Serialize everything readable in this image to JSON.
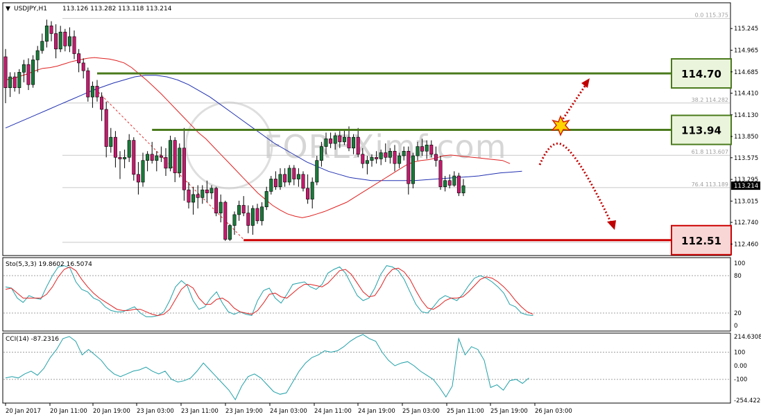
{
  "chart_data": [
    {
      "type": "candlestick",
      "header": {
        "symbol": "USDJPY,H1",
        "ohlc": "113.126 113.282 113.118 113.214"
      },
      "watermark": "FOREXimf.com",
      "ylim": [
        112.32,
        115.56
      ],
      "y_ticks": [
        "115.245",
        "114.965",
        "114.685",
        "114.410",
        "114.130",
        "113.850",
        "113.575",
        "113.295",
        "113.015",
        "112.740",
        "112.460"
      ],
      "y_tick_values": [
        115.245,
        114.965,
        114.685,
        114.41,
        114.13,
        113.85,
        113.575,
        113.295,
        113.015,
        112.74,
        112.46
      ],
      "current_price": "113.214",
      "current_price_value": 113.214,
      "x_labels": [
        "20 Jan 2017",
        "20 Jan 11:00",
        "20 Jan 19:00",
        "23 Jan 03:00",
        "23 Jan 11:00",
        "23 Jan 19:00",
        "24 Jan 03:00",
        "24 Jan 11:00",
        "24 Jan 19:00",
        "25 Jan 03:00",
        "25 Jan 11:00",
        "25 Jan 19:00",
        "26 Jan 03:00"
      ],
      "fibonacci": [
        {
          "label": "0.0  115.375",
          "value": 115.375
        },
        {
          "label": "38.2  114.282",
          "value": 114.282
        },
        {
          "label": "61.8  113.607",
          "value": 113.607
        },
        {
          "label": "76.4  113.189",
          "value": 113.189
        }
      ],
      "levels": [
        {
          "label": "114.70",
          "value": 114.665,
          "color": "#4a7a1c",
          "box_fill": "#eaf4dc",
          "start_bar": 20
        },
        {
          "label": "113.94",
          "value": 113.935,
          "color": "#4a7a1c",
          "box_fill": "#eaf4dc",
          "start_bar": 32
        },
        {
          "label": "112.51",
          "value": 112.51,
          "color": "#cc0000",
          "box_fill": "#f9d6d6",
          "start_bar": 52
        }
      ],
      "colors": {
        "bull": "#1a7a3a",
        "bear": "#c8186e",
        "ma_fast": "#e02020",
        "ma_slow": "#2030b0",
        "arrow": "#c00000"
      },
      "candles": [
        [
          114.88,
          114.98,
          114.28,
          114.48
        ],
        [
          114.48,
          114.68,
          114.36,
          114.62
        ],
        [
          114.62,
          114.68,
          114.43,
          114.48
        ],
        [
          114.48,
          114.72,
          114.4,
          114.68
        ],
        [
          114.68,
          114.84,
          114.55,
          114.78
        ],
        [
          114.78,
          114.86,
          114.45,
          114.52
        ],
        [
          114.52,
          114.9,
          114.48,
          114.84
        ],
        [
          114.84,
          115.02,
          114.68,
          114.96
        ],
        [
          114.96,
          115.18,
          114.92,
          115.08
        ],
        [
          115.08,
          115.36,
          115.0,
          115.28
        ],
        [
          115.28,
          115.34,
          115.08,
          115.18
        ],
        [
          115.18,
          115.3,
          114.86,
          114.98
        ],
        [
          114.98,
          115.28,
          114.94,
          115.2
        ],
        [
          115.2,
          115.24,
          114.95,
          115.02
        ],
        [
          115.02,
          115.26,
          114.94,
          115.14
        ],
        [
          115.14,
          115.22,
          114.85,
          114.92
        ],
        [
          114.92,
          114.98,
          114.68,
          114.8
        ],
        [
          114.8,
          114.86,
          114.6,
          114.7
        ],
        [
          114.7,
          114.74,
          114.3,
          114.36
        ],
        [
          114.36,
          114.56,
          114.22,
          114.5
        ],
        [
          114.5,
          114.58,
          114.3,
          114.36
        ],
        [
          114.36,
          114.42,
          114.05,
          114.2
        ],
        [
          114.2,
          114.3,
          113.58,
          113.72
        ],
        [
          113.72,
          113.96,
          113.64,
          113.84
        ],
        [
          113.84,
          113.92,
          113.45,
          113.58
        ],
        [
          113.58,
          113.66,
          113.3,
          113.56
        ],
        [
          113.56,
          113.68,
          113.44,
          113.58
        ],
        [
          113.58,
          113.88,
          113.52,
          113.8
        ],
        [
          113.8,
          113.84,
          113.28,
          113.36
        ],
        [
          113.36,
          113.52,
          113.1,
          113.26
        ],
        [
          113.26,
          113.64,
          113.2,
          113.54
        ],
        [
          113.54,
          113.66,
          113.4,
          113.62
        ],
        [
          113.62,
          113.78,
          113.5,
          113.54
        ],
        [
          113.54,
          113.66,
          113.4,
          113.6
        ],
        [
          113.6,
          113.72,
          113.52,
          113.58
        ],
        [
          113.58,
          113.7,
          113.34,
          113.44
        ],
        [
          113.44,
          113.86,
          113.4,
          113.8
        ],
        [
          113.8,
          113.84,
          113.26,
          113.38
        ],
        [
          113.38,
          113.76,
          113.32,
          113.7
        ],
        [
          113.7,
          113.96,
          113.02,
          113.16
        ],
        [
          113.16,
          113.26,
          112.92,
          113.0
        ],
        [
          113.0,
          113.2,
          112.84,
          113.1
        ],
        [
          113.1,
          113.22,
          112.92,
          113.06
        ],
        [
          113.06,
          113.22,
          112.98,
          113.16
        ],
        [
          113.16,
          113.28,
          113.0,
          113.12
        ],
        [
          113.12,
          113.22,
          113.04,
          113.18
        ],
        [
          113.18,
          113.2,
          112.82,
          112.86
        ],
        [
          112.86,
          113.1,
          112.74,
          113.0
        ],
        [
          113.0,
          113.02,
          112.5,
          112.52
        ],
        [
          112.52,
          112.72,
          112.5,
          112.7
        ],
        [
          112.7,
          112.88,
          112.58,
          112.84
        ],
        [
          112.84,
          113.02,
          112.76,
          112.96
        ],
        [
          112.96,
          113.08,
          112.82,
          112.86
        ],
        [
          112.86,
          112.96,
          112.6,
          112.7
        ],
        [
          112.7,
          112.96,
          112.58,
          112.92
        ],
        [
          112.92,
          112.98,
          112.72,
          112.76
        ],
        [
          112.76,
          113.0,
          112.7,
          112.94
        ],
        [
          112.94,
          113.2,
          112.9,
          113.14
        ],
        [
          113.14,
          113.34,
          113.1,
          113.3
        ],
        [
          113.3,
          113.4,
          113.16,
          113.2
        ],
        [
          113.2,
          113.44,
          113.16,
          113.36
        ],
        [
          113.36,
          113.44,
          113.2,
          113.26
        ],
        [
          113.26,
          113.48,
          113.22,
          113.44
        ],
        [
          113.44,
          113.48,
          113.22,
          113.3
        ],
        [
          113.3,
          113.44,
          113.2,
          113.36
        ],
        [
          113.36,
          113.4,
          113.14,
          113.18
        ],
        [
          113.18,
          113.36,
          112.98,
          113.04
        ],
        [
          113.04,
          113.32,
          112.92,
          113.26
        ],
        [
          113.26,
          113.6,
          113.22,
          113.54
        ],
        [
          113.54,
          113.78,
          113.46,
          113.72
        ],
        [
          113.72,
          113.9,
          113.62,
          113.82
        ],
        [
          113.82,
          113.9,
          113.7,
          113.76
        ],
        [
          113.76,
          113.9,
          113.68,
          113.86
        ],
        [
          113.86,
          113.92,
          113.7,
          113.78
        ],
        [
          113.78,
          113.94,
          113.74,
          113.84
        ],
        [
          113.84,
          113.98,
          113.66,
          113.7
        ],
        [
          113.7,
          113.88,
          113.62,
          113.84
        ],
        [
          113.84,
          113.96,
          113.58,
          113.62
        ],
        [
          113.62,
          113.7,
          113.44,
          113.5
        ],
        [
          113.5,
          113.6,
          113.36,
          113.54
        ],
        [
          113.54,
          113.62,
          113.46,
          113.58
        ],
        [
          113.58,
          113.66,
          113.5,
          113.56
        ],
        [
          113.56,
          113.68,
          113.48,
          113.64
        ],
        [
          113.64,
          113.76,
          113.52,
          113.58
        ],
        [
          113.58,
          113.7,
          113.5,
          113.66
        ],
        [
          113.66,
          113.74,
          113.4,
          113.5
        ],
        [
          113.5,
          113.64,
          113.44,
          113.6
        ],
        [
          113.6,
          113.72,
          113.54,
          113.66
        ],
        [
          113.66,
          113.72,
          113.1,
          113.24
        ],
        [
          113.24,
          113.64,
          113.18,
          113.6
        ],
        [
          113.6,
          113.78,
          113.54,
          113.72
        ],
        [
          113.72,
          113.82,
          113.6,
          113.66
        ],
        [
          113.66,
          113.8,
          113.56,
          113.74
        ],
        [
          113.74,
          113.8,
          113.58,
          113.62
        ],
        [
          113.62,
          113.72,
          113.46,
          113.54
        ],
        [
          113.54,
          113.6,
          113.16,
          113.2
        ],
        [
          113.2,
          113.34,
          113.14,
          113.28
        ],
        [
          113.28,
          113.36,
          113.18,
          113.22
        ],
        [
          113.22,
          113.4,
          113.2,
          113.34
        ],
        [
          113.34,
          113.38,
          113.08,
          113.12
        ],
        [
          113.12,
          113.3,
          113.08,
          113.214
        ]
      ],
      "ma_fast": [
        114.58,
        114.6,
        114.63,
        114.66,
        114.7,
        114.73,
        114.74,
        114.76,
        114.79,
        114.82,
        114.84,
        114.86,
        114.87,
        114.86,
        114.85,
        114.83,
        114.8,
        114.74,
        114.66,
        114.58,
        114.49,
        114.4,
        114.3,
        114.2,
        114.1,
        114.0,
        113.9,
        113.82,
        113.72,
        113.62,
        113.52,
        113.42,
        113.32,
        113.22,
        113.12,
        113.04,
        112.96,
        112.9,
        112.85,
        112.82,
        112.8,
        112.82,
        112.85,
        112.88,
        112.92,
        112.96,
        113.0,
        113.06,
        113.12,
        113.18,
        113.24,
        113.3,
        113.36,
        113.42,
        113.48,
        113.52,
        113.54,
        113.55,
        113.57,
        113.6,
        113.61,
        113.6,
        113.59,
        113.58,
        113.57,
        113.56,
        113.55,
        113.54,
        113.5
      ],
      "ma_slow": [
        113.96,
        114.02,
        114.08,
        114.14,
        114.2,
        114.26,
        114.32,
        114.38,
        114.44,
        114.49,
        114.54,
        114.58,
        114.62,
        114.64,
        114.64,
        114.62,
        114.58,
        114.52,
        114.44,
        114.36,
        114.26,
        114.16,
        114.06,
        113.96,
        113.86,
        113.76,
        113.68,
        113.6,
        113.52,
        113.46,
        113.4,
        113.36,
        113.32,
        113.3,
        113.28,
        113.28,
        113.28,
        113.28,
        113.28,
        113.29,
        113.3,
        113.31,
        113.32,
        113.33,
        113.34,
        113.36,
        113.38,
        113.39,
        113.4
      ],
      "sto_header": "Sto(5,3,3) 19.8602 16.5074",
      "sto_ticks": [
        "100",
        "80",
        "20",
        "0"
      ],
      "sto_main": [
        62,
        60,
        44,
        37,
        48,
        44,
        42,
        62,
        80,
        94,
        96,
        92,
        70,
        58,
        54,
        44,
        40,
        30,
        24,
        22,
        22,
        26,
        30,
        20,
        14,
        14,
        16,
        22,
        40,
        62,
        72,
        64,
        40,
        26,
        30,
        44,
        54,
        36,
        22,
        18,
        22,
        18,
        16,
        40,
        56,
        60,
        44,
        36,
        50,
        66,
        68,
        70,
        62,
        58,
        66,
        84,
        90,
        94,
        84,
        66,
        48,
        40,
        44,
        60,
        82,
        96,
        94,
        88,
        74,
        54,
        34,
        22,
        20,
        30,
        42,
        48,
        44,
        40,
        50,
        64,
        76,
        80,
        76,
        70,
        62,
        52,
        34,
        30,
        20,
        17,
        16
      ],
      "sto_signal": [
        58,
        60,
        52,
        44,
        44,
        44,
        44,
        50,
        62,
        78,
        90,
        94,
        88,
        74,
        62,
        52,
        44,
        38,
        32,
        26,
        24,
        24,
        26,
        26,
        22,
        18,
        16,
        18,
        26,
        42,
        58,
        66,
        60,
        44,
        34,
        34,
        42,
        44,
        38,
        28,
        22,
        20,
        18,
        24,
        36,
        50,
        52,
        46,
        44,
        52,
        60,
        66,
        66,
        64,
        62,
        68,
        78,
        88,
        90,
        82,
        68,
        54,
        46,
        48,
        62,
        80,
        90,
        92,
        86,
        74,
        56,
        40,
        28,
        26,
        32,
        40,
        44,
        44,
        46,
        54,
        64,
        74,
        78,
        76,
        70,
        62,
        52,
        40,
        30,
        22,
        18
      ],
      "cci_header": "CCI(14) -87.2316",
      "cci_ticks": [
        "214.6308",
        "100",
        "0.00",
        "-100",
        "-254.4226"
      ],
      "cci": [
        -90,
        -80,
        -90,
        -60,
        -40,
        -70,
        -20,
        60,
        120,
        200,
        215,
        180,
        80,
        120,
        80,
        40,
        -20,
        -60,
        -80,
        -60,
        -40,
        -30,
        -10,
        -40,
        -60,
        -40,
        -100,
        -120,
        -110,
        -90,
        -40,
        20,
        -30,
        -80,
        -130,
        -180,
        -250,
        -150,
        -80,
        -60,
        -90,
        -140,
        -190,
        -210,
        -200,
        -120,
        -40,
        20,
        60,
        80,
        110,
        100,
        110,
        140,
        180,
        210,
        230,
        200,
        180,
        100,
        40,
        0,
        20,
        30,
        0,
        -40,
        -70,
        -100,
        -160,
        -230,
        -150,
        200,
        80,
        140,
        120,
        40,
        -160,
        -140,
        -180,
        -110,
        -100,
        -130,
        -90
      ]
    }
  ]
}
